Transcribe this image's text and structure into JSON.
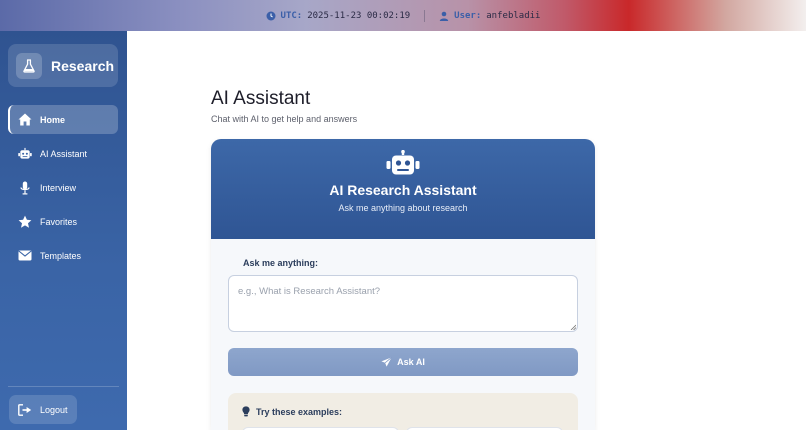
{
  "topbar": {
    "utc_label": "UTC:",
    "utc_value": "2025-11-23 00:02:19",
    "user_label": "User:",
    "user_value": "anfebladii"
  },
  "sidebar": {
    "brand": "Research",
    "items": [
      {
        "label": "Home",
        "icon": "home-icon",
        "active": true
      },
      {
        "label": "AI Assistant",
        "icon": "robot-icon",
        "active": false
      },
      {
        "label": "Interview",
        "icon": "microphone-icon",
        "active": false
      },
      {
        "label": "Favorites",
        "icon": "star-icon",
        "active": false
      },
      {
        "label": "Templates",
        "icon": "envelope-icon",
        "active": false
      }
    ],
    "logout": "Logout"
  },
  "main": {
    "title": "AI Assistant",
    "subtitle": "Chat with AI to get help and answers",
    "card": {
      "title": "AI Research Assistant",
      "subtitle": "Ask me anything about research",
      "field_label": "Ask me anything:",
      "placeholder": "e.g., What is Research Assistant?",
      "input_value": "",
      "button": "Ask AI",
      "examples_title": "Try these examples:"
    }
  },
  "colors": {
    "sidebar": "#3a64a6",
    "header": "#2f5594",
    "button": "#8099c4",
    "examples_bg": "#f1ede4"
  }
}
